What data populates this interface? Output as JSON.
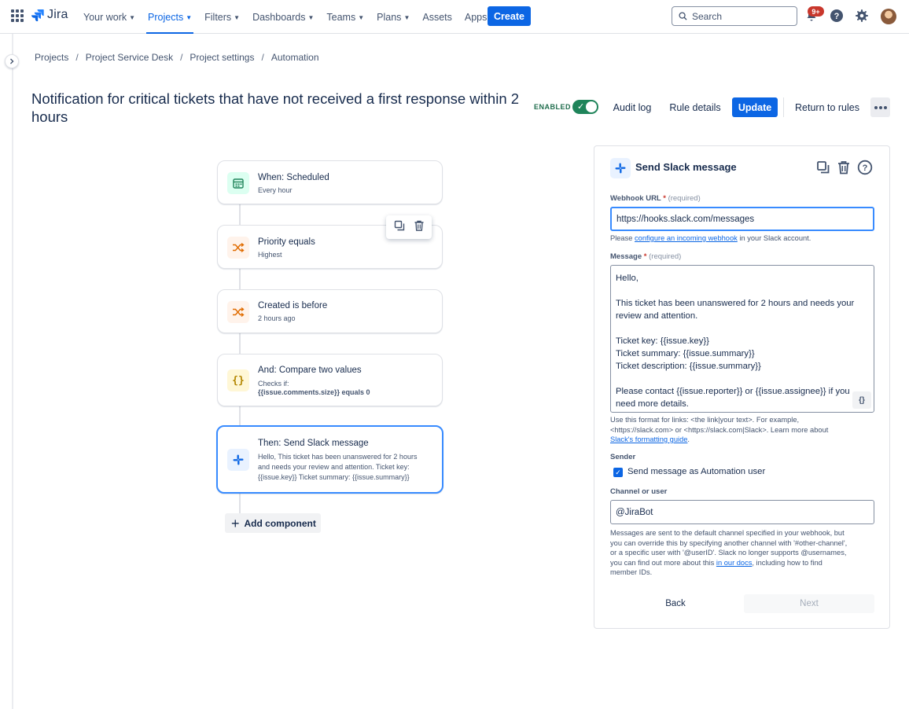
{
  "topnav": {
    "logo_text": "Jira",
    "items": [
      {
        "label": "Your work",
        "has_menu": true,
        "active": false
      },
      {
        "label": "Projects",
        "has_menu": true,
        "active": true
      },
      {
        "label": "Filters",
        "has_menu": true,
        "active": false
      },
      {
        "label": "Dashboards",
        "has_menu": true,
        "active": false
      },
      {
        "label": "Teams",
        "has_menu": true,
        "active": false
      },
      {
        "label": "Plans",
        "has_menu": true,
        "active": false
      },
      {
        "label": "Assets",
        "has_menu": false,
        "active": false
      },
      {
        "label": "Apps",
        "has_menu": true,
        "active": false
      }
    ],
    "create_label": "Create",
    "search_placeholder": "Search",
    "notification_badge": "9+",
    "icons": [
      "app-switcher-icon",
      "notifications-icon",
      "help-icon",
      "settings-icon"
    ]
  },
  "breadcrumb": [
    "Projects",
    "Project Service Desk",
    "Project settings",
    "Automation"
  ],
  "header": {
    "title": "Notification for critical tickets that have not received a first response within 2 hours",
    "enabled_label": "ENABLED",
    "enabled": true,
    "audit_log": "Audit log",
    "rule_details": "Rule details",
    "update": "Update",
    "return_to_rules": "Return to rules"
  },
  "flow": {
    "components": [
      {
        "title": "When: Scheduled",
        "subtitle": "Every hour",
        "icon": "calendar-icon"
      },
      {
        "title": "Priority equals",
        "subtitle": "Highest",
        "icon": "shuffle-icon"
      },
      {
        "title": "Created is before",
        "subtitle": "2 hours ago",
        "icon": "shuffle-icon"
      },
      {
        "title": "And: Compare two values",
        "subtitle": "Checks if:",
        "subtitle_bold": "{{issue.comments.size}} equals 0",
        "icon": "braces-icon"
      },
      {
        "title": "Then: Send Slack message",
        "subtitle_lines": [
          "Hello, This ticket has been unanswered for 2 hours",
          "and needs your review and attention. Ticket key:",
          "{{issue.key}} Ticket summary: {{issue.summary}}"
        ],
        "icon": "slack-icon",
        "selected": true
      }
    ],
    "add_component": "Add component"
  },
  "panel": {
    "title": "Send Slack message",
    "webhook": {
      "label": "Webhook URL",
      "required_mark": "*",
      "optional_text": "(required)",
      "value": "https://hooks.slack.com/messages",
      "help_prefix": "Please",
      "help_link": "configure an incoming webhook",
      "help_suffix": "in your Slack account."
    },
    "message": {
      "label": "Message",
      "required_mark": "*",
      "optional_text": "(required)",
      "lines": [
        "Hello,",
        "",
        "This ticket has been unanswered for 2 hours and needs your",
        "review and attention.",
        "",
        "Ticket key: {{issue.key}}",
        "Ticket summary: {{issue.summary}}",
        "Ticket description: {{issue.summary}}",
        "",
        "Please contact {{issue.reporter}} or {{issue.assignee}} if you",
        "need more details."
      ],
      "smart_values_label": "{}",
      "help_line1": "Use this format for links: <the link|your text>. For example,",
      "help_line2": "<https://slack.com> or <https://slack.com|Slack>. Learn more about",
      "help_link": "Slack's formatting guide",
      "help_end": "."
    },
    "sender": {
      "label": "Sender",
      "checkbox_label": "Send message as Automation user",
      "checked": true
    },
    "channel": {
      "label": "Channel or user",
      "value": "@JiraBot",
      "help_line1": "Messages are sent to the default channel specified in your webhook, but",
      "help_line2": "you can override this by specifying another channel with '#other-channel',",
      "help_line3": "or a specific user with '@userID'. Slack no longer supports @usernames,",
      "help_line4_prefix": "you can find out more about this",
      "help_line4_link": "in our docs",
      "help_line4_suffix": ", including how to find",
      "help_line5": "member IDs."
    },
    "back": "Back",
    "next": "Next"
  },
  "colors": {
    "primary": "#0c66e4",
    "enabled_green": "#1f845a",
    "selected_border": "#388bff"
  }
}
